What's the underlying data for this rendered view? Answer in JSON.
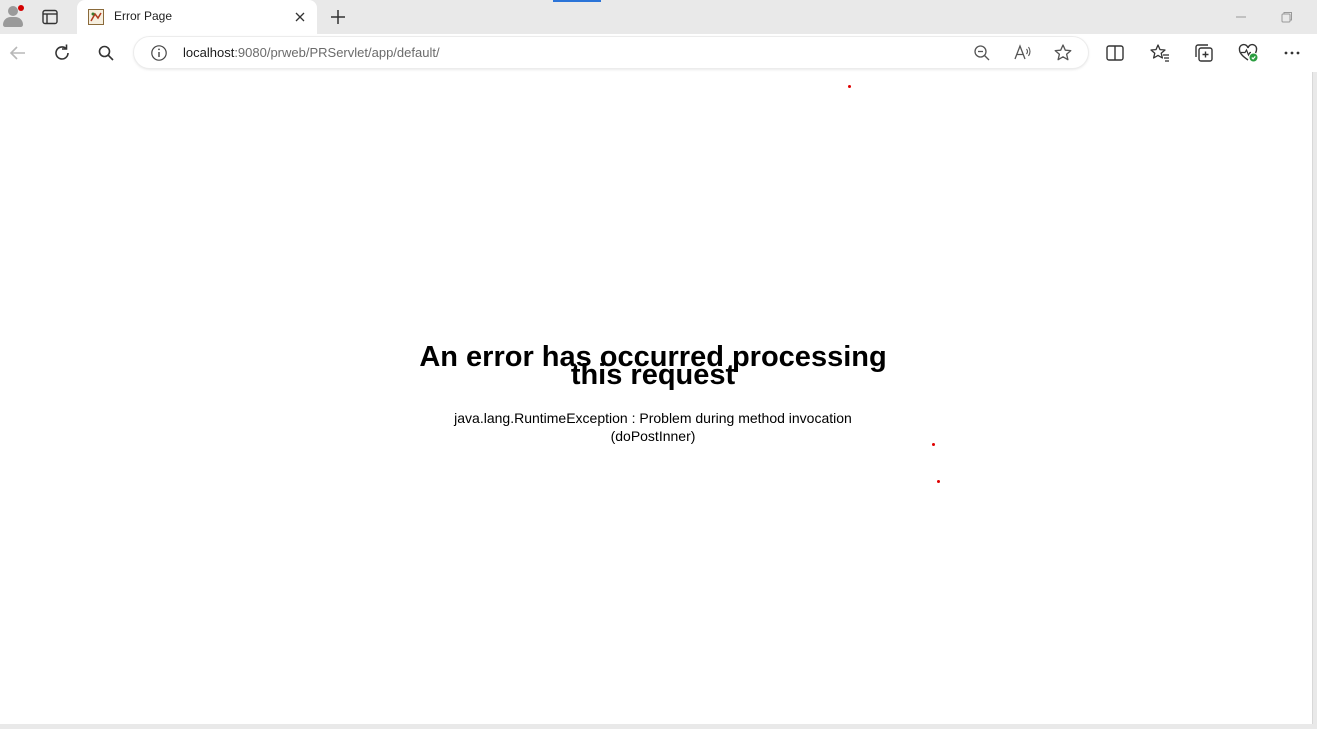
{
  "tab": {
    "title": "Error Page"
  },
  "address_bar": {
    "url_host": "localhost",
    "url_rest": ":9080/prweb/PRServlet/app/default/"
  },
  "icons": {
    "profile": "profile-icon",
    "tab_actions": "tab-actions-icon",
    "favicon": "page-favicon-icon",
    "close": "close-icon",
    "new_tab": "plus-icon",
    "back": "back-arrow-icon",
    "refresh": "refresh-icon",
    "search": "search-icon",
    "info": "info-icon",
    "zoom_out": "zoom-out-icon",
    "read_aloud": "read-aloud-icon",
    "favorite": "star-icon",
    "split_screen": "split-screen-icon",
    "favorites": "favorites-icon",
    "collections": "collections-icon",
    "browser_essentials": "heart-pulse-icon",
    "more": "more-icon"
  },
  "colors": {
    "accent": "#2b74d8",
    "alert_dot": "#d40000"
  },
  "page": {
    "heading": "An error has occurred processing this request",
    "message": "java.lang.RuntimeException : Problem during method invocation (doPostInner)"
  }
}
